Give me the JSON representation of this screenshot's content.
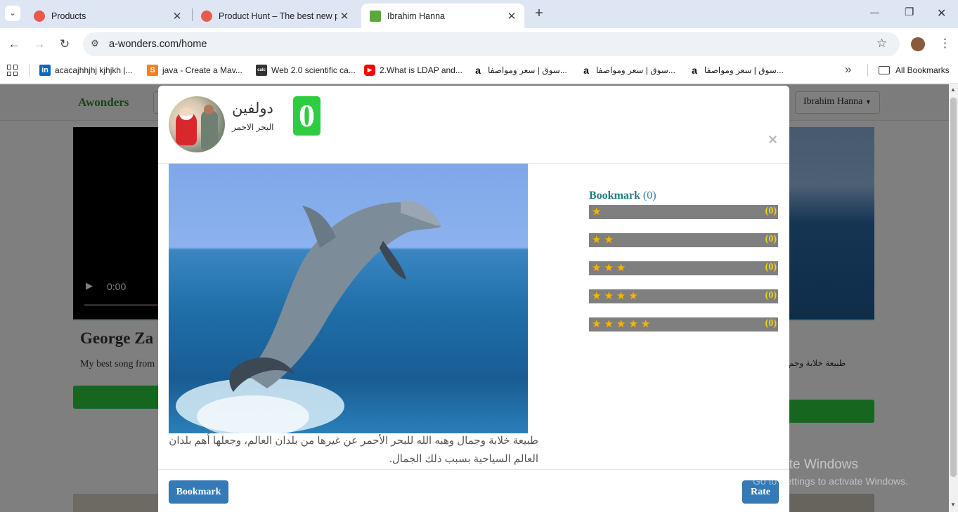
{
  "browser": {
    "tabs": [
      {
        "title": "Products",
        "favicon_color": "#ea5a4b",
        "active": false
      },
      {
        "title": "Product Hunt – The best new pr",
        "favicon_color": "#ea5a4b",
        "active": false
      },
      {
        "title": "Ibrahim Hanna",
        "favicon_color": "#5aa83b",
        "active": true
      }
    ],
    "new_tab_label": "+",
    "url": "a-wonders.com/home",
    "window_controls": {
      "minimize": "—",
      "restore": "❐",
      "close": "✕"
    }
  },
  "bookmarks_bar": {
    "items": [
      {
        "label": "acacajhhjhj kjhjkh |...",
        "icon": "linkedin-icon",
        "icon_text": "in",
        "color": "#0a66c2"
      },
      {
        "label": "java - Create a Mav...",
        "icon": "stackoverflow-icon",
        "icon_text": "S",
        "color": "#f48024"
      },
      {
        "label": "Web 2.0 scientific ca...",
        "icon": "calculator-icon",
        "icon_text": "calc",
        "color": "#333333"
      },
      {
        "label": "2.What is LDAP and...",
        "icon": "youtube-icon",
        "icon_text": "▶",
        "color": "#ff0000"
      },
      {
        "label": "سوق | سعر ومواصفا...",
        "icon": "amazon-icon",
        "icon_text": "a",
        "color": "#ffffff"
      },
      {
        "label": "سوق | سعر ومواصفا...",
        "icon": "amazon-icon",
        "icon_text": "a",
        "color": "#ffffff"
      },
      {
        "label": "سوق | سعر ومواصفا...",
        "icon": "amazon-icon",
        "icon_text": "a",
        "color": "#ffffff"
      }
    ],
    "overflow_label": "»",
    "all_bookmarks_label": "All Bookmarks"
  },
  "site": {
    "brand": "Awonders",
    "user_menu": "Ibrahim Hanna",
    "video_time": "0:00",
    "card_title": "George Za",
    "card_text": "My best song from",
    "right_card_text": "طبيعة خلابة وجم"
  },
  "modal": {
    "title": "دولفين",
    "subtitle": "البحر الاحمر",
    "score": "0",
    "close_label": "×",
    "description": "طبيعة خلابة وجمال وهبه الله للبحر الأحمر  عن غيرها من بلدان العالم، وجعلها أهم بلدان العالم السياحية بسبب ذلك الجمال.",
    "bookmark_heading": "Bookmark",
    "bookmark_count": "(0)",
    "ratings": [
      {
        "stars": 1,
        "count": "(0)"
      },
      {
        "stars": 2,
        "count": "(0)"
      },
      {
        "stars": 3,
        "count": "(0)"
      },
      {
        "stars": 4,
        "count": "(0)"
      },
      {
        "stars": 5,
        "count": "(0)"
      }
    ],
    "bookmark_button": "Bookmark",
    "rate_button": "Rate"
  },
  "watermark": {
    "line1": "Activate Windows",
    "line2": "Go to Settings to activate Windows."
  },
  "colors": {
    "score_badge": "#2ecc40",
    "brand_green": "#2e8b2e",
    "button_green": "#2ecc40",
    "primary_blue": "#337ab7",
    "heading_teal": "#1d7f7f",
    "rating_bar": "#7f7f7f",
    "star": "#f5b500"
  }
}
